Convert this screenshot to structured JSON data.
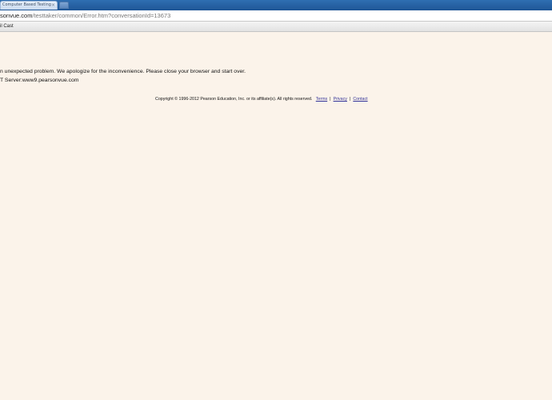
{
  "browser": {
    "tab": {
      "title": "Computer Based Testing",
      "close_glyph": "×"
    },
    "address": {
      "url_domain": "sonvue.com",
      "url_path": "/testtaker/common/Error.htm?conversationId=13673"
    },
    "bookmarks": [
      {
        "label": "il Cast"
      }
    ]
  },
  "page": {
    "error_message": "n unexpected problem. We apologize for the inconvenience. Please close your browser and start over.",
    "server_info": "T Server:www9.pearsonvue.com",
    "footer": {
      "copyright": "Copyright © 1996-2012 Pearson Education, Inc. or its affiliate(s). All rights reserved.",
      "links": {
        "terms": "Terms",
        "privacy": "Privacy",
        "contact": "Contact"
      },
      "separator": "|"
    }
  },
  "colors": {
    "page_background": "#fbf3ea",
    "tab_strip": "#1f5696",
    "link": "#333399"
  }
}
